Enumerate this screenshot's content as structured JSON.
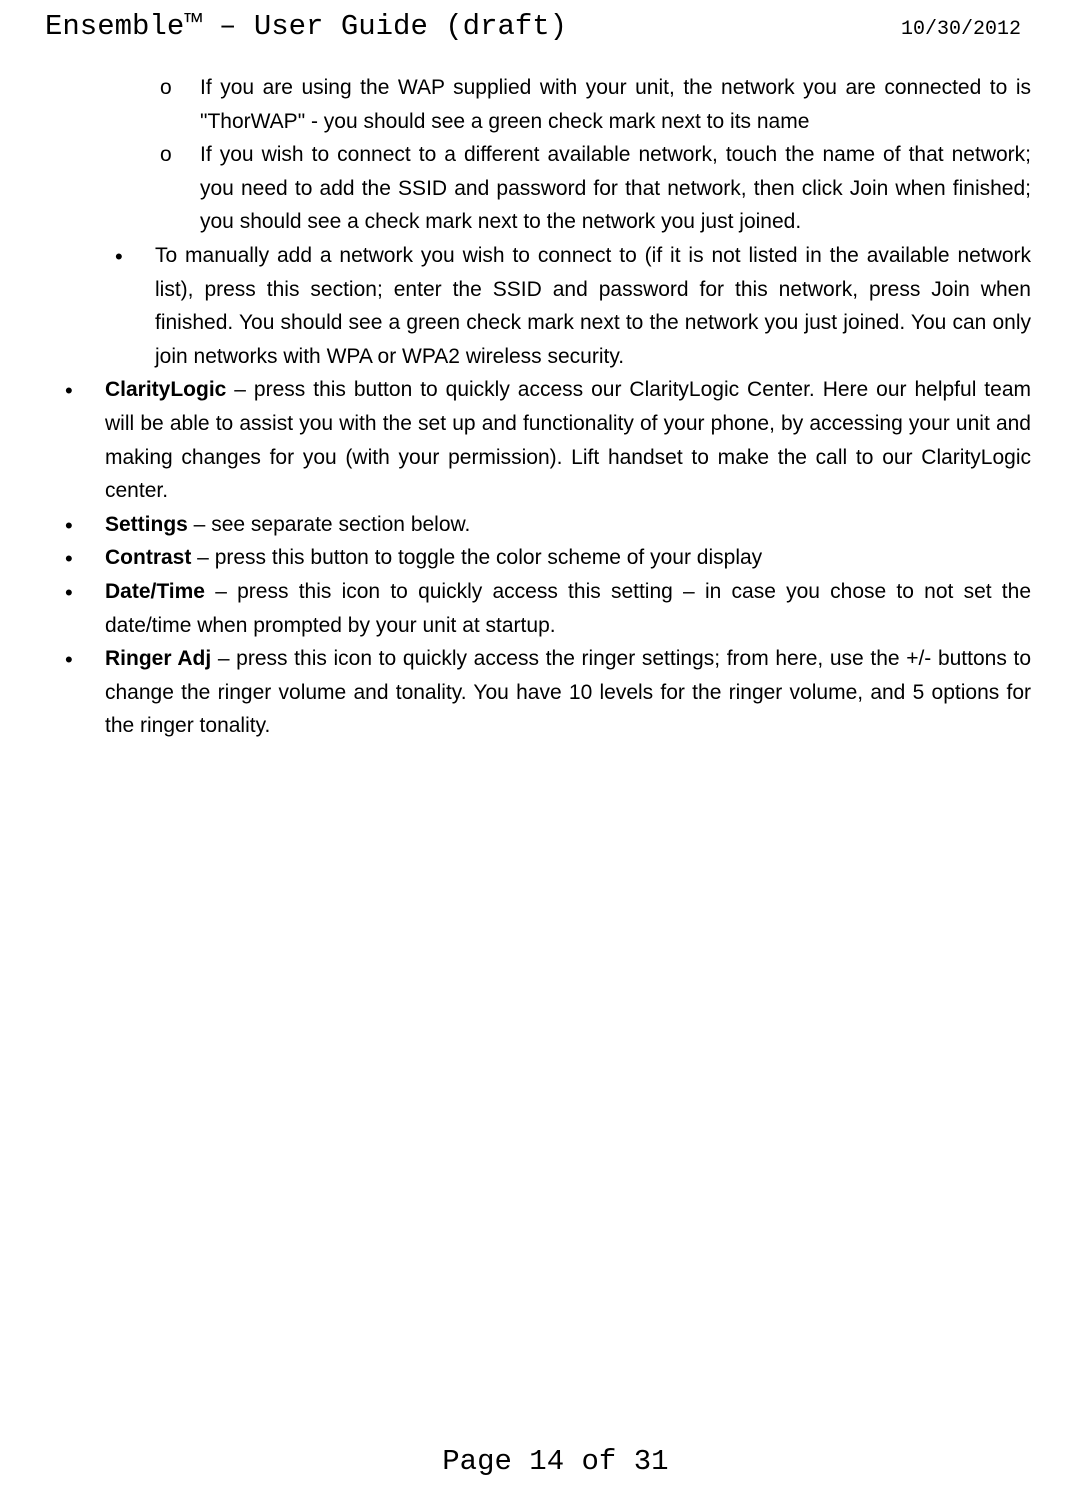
{
  "header": {
    "title": "Ensemble™ – User Guide (draft)",
    "date": "10/30/2012"
  },
  "sub_sub_items": [
    {
      "text": "If you are using the WAP supplied with your unit, the network you are connected to is \"ThorWAP\"  - you should see a green check mark next to its name"
    },
    {
      "text": "If you wish to connect to a different available network, touch the name of that network; you need to add the SSID and password for that network, then click Join when finished; you should see a check mark next to the network you just joined."
    }
  ],
  "sub_items": [
    {
      "text": "To manually add a network you wish to connect to (if it is not listed in the available network list), press this section; enter the SSID and password for this network, press Join when finished. You should see a green check mark next to the network you just joined.  You can only join networks with WPA or WPA2 wireless security."
    }
  ],
  "main_items": [
    {
      "bold": "ClarityLogic",
      "rest": " – press this button to quickly access our ClarityLogic Center. Here our helpful team will be able to assist you with the set up and functionality of your phone, by accessing your unit and making changes for you (with your permission). Lift handset to make the call to our ClarityLogic center."
    },
    {
      "bold": "Settings",
      "rest": " – see separate section below."
    },
    {
      "bold": "Contrast",
      "rest": " – press this button to toggle the color scheme of your display"
    },
    {
      "bold": "Date/Time",
      "rest": " – press this icon to quickly access this setting – in case you chose to not set the date/time when prompted by your unit at startup."
    },
    {
      "bold": "Ringer Adj",
      "rest": " – press this icon to quickly access the ringer settings; from here, use the +/- buttons to change the ringer volume and tonality. You have 10 levels for the ringer volume, and 5 options for the ringer tonality."
    }
  ],
  "footer": {
    "text": "Page 14 of 31"
  }
}
